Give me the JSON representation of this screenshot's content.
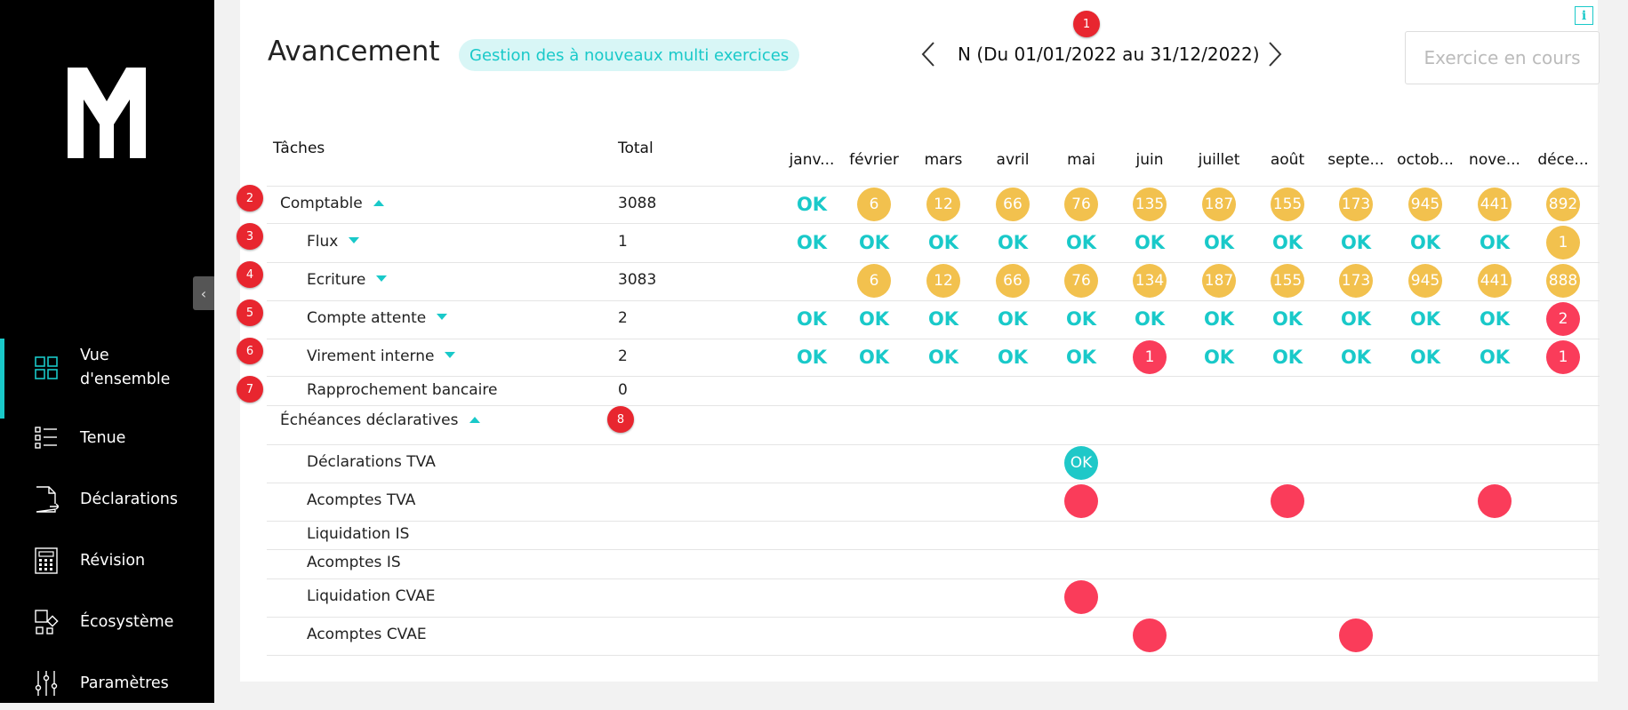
{
  "sidebar": {
    "items": [
      {
        "label": "Vue d'ensemble",
        "icon": "grid-icon",
        "active": true
      },
      {
        "label": "Tenue",
        "icon": "list-icon"
      },
      {
        "label": "Déclarations",
        "icon": "document-icon"
      },
      {
        "label": "Révision",
        "icon": "calculator-icon"
      },
      {
        "label": "Écosystème",
        "icon": "ecosystem-icon"
      },
      {
        "label": "Paramètres",
        "icon": "sliders-icon"
      }
    ]
  },
  "header": {
    "title": "Avancement",
    "tag": "Gestion des à nouveaux multi exercices",
    "period": "N (Du 01/01/2022 au 31/12/2022)",
    "exercise_button": "Exercice en cours",
    "info_icon": "i"
  },
  "markers": [
    "1",
    "2",
    "3",
    "4",
    "5",
    "6",
    "7",
    "8"
  ],
  "table": {
    "col_tasks": "Tâches",
    "col_total": "Total",
    "months": [
      "janv...",
      "février",
      "mars",
      "avril",
      "mai",
      "juin",
      "juillet",
      "août",
      "septe...",
      "octob...",
      "nove...",
      "déce..."
    ],
    "rows": [
      {
        "label": "Comptable",
        "caret": "up",
        "total": "3088",
        "cells": [
          "OK",
          "6",
          "12",
          "66",
          "76",
          "135",
          "187",
          "155",
          "173",
          "945",
          "441",
          "892"
        ],
        "kinds": [
          "ok",
          "warn",
          "warn",
          "warn",
          "warn",
          "warn",
          "warn",
          "warn",
          "warn",
          "warn",
          "warn",
          "warn"
        ]
      },
      {
        "label": "Flux",
        "caret": "down",
        "total": "1",
        "cells": [
          "OK",
          "OK",
          "OK",
          "OK",
          "OK",
          "OK",
          "OK",
          "OK",
          "OK",
          "OK",
          "OK",
          "1"
        ],
        "kinds": [
          "ok",
          "ok",
          "ok",
          "ok",
          "ok",
          "ok",
          "ok",
          "ok",
          "ok",
          "ok",
          "ok",
          "warn"
        ]
      },
      {
        "label": "Ecriture",
        "caret": "down",
        "total": "3083",
        "cells": [
          "",
          "6",
          "12",
          "66",
          "76",
          "134",
          "187",
          "155",
          "173",
          "945",
          "441",
          "888"
        ],
        "kinds": [
          "",
          "warn",
          "warn",
          "warn",
          "warn",
          "warn",
          "warn",
          "warn",
          "warn",
          "warn",
          "warn",
          "warn"
        ]
      },
      {
        "label": "Compte attente",
        "caret": "down",
        "total": "2",
        "cells": [
          "OK",
          "OK",
          "OK",
          "OK",
          "OK",
          "OK",
          "OK",
          "OK",
          "OK",
          "OK",
          "OK",
          "2"
        ],
        "kinds": [
          "ok",
          "ok",
          "ok",
          "ok",
          "ok",
          "ok",
          "ok",
          "ok",
          "ok",
          "ok",
          "ok",
          "error"
        ]
      },
      {
        "label": "Virement interne",
        "caret": "down",
        "total": "2",
        "cells": [
          "OK",
          "OK",
          "OK",
          "OK",
          "OK",
          "1",
          "OK",
          "OK",
          "OK",
          "OK",
          "OK",
          "1"
        ],
        "kinds": [
          "ok",
          "ok",
          "ok",
          "ok",
          "ok",
          "error",
          "ok",
          "ok",
          "ok",
          "ok",
          "ok",
          "error"
        ]
      },
      {
        "label": "Rapprochement bancaire",
        "caret": "",
        "total": "0",
        "cells": [
          "",
          "",
          "",
          "",
          "",
          "",
          "",
          "",
          "",
          "",
          "",
          ""
        ],
        "kinds": [
          "",
          "",
          "",
          "",
          "",
          "",
          "",
          "",
          "",
          "",
          "",
          ""
        ]
      },
      {
        "label": "Échéances déclaratives",
        "caret": "up",
        "total": "",
        "cells": [
          "",
          "",
          "",
          "",
          "",
          "",
          "",
          "",
          "",
          "",
          "",
          ""
        ],
        "kinds": [
          "",
          "",
          "",
          "",
          "",
          "",
          "",
          "",
          "",
          "",
          "",
          ""
        ]
      },
      {
        "label": "Déclarations TVA",
        "caret": "",
        "total": "",
        "cells": [
          "",
          "",
          "",
          "",
          "OK",
          "",
          "",
          "",
          "",
          "",
          "",
          ""
        ],
        "kinds": [
          "",
          "",
          "",
          "",
          "done",
          "",
          "",
          "",
          "",
          "",
          "",
          ""
        ]
      },
      {
        "label": "Acomptes TVA",
        "caret": "",
        "total": "",
        "cells": [
          "",
          "",
          "",
          "",
          "",
          "",
          "",
          "",
          "",
          "",
          "",
          ""
        ],
        "kinds": [
          "",
          "",
          "",
          "",
          "error",
          "",
          "",
          "error",
          "",
          "",
          "error",
          ""
        ]
      },
      {
        "label": "Liquidation IS",
        "caret": "",
        "total": "",
        "cells": [
          "",
          "",
          "",
          "",
          "",
          "",
          "",
          "",
          "",
          "",
          "",
          ""
        ],
        "kinds": [
          "",
          "",
          "",
          "",
          "",
          "",
          "",
          "",
          "",
          "",
          "",
          ""
        ]
      },
      {
        "label": "Acomptes IS",
        "caret": "",
        "total": "",
        "cells": [
          "",
          "",
          "",
          "",
          "",
          "",
          "",
          "",
          "",
          "",
          "",
          ""
        ],
        "kinds": [
          "",
          "",
          "",
          "",
          "",
          "",
          "",
          "",
          "",
          "",
          "",
          ""
        ]
      },
      {
        "label": "Liquidation CVAE",
        "caret": "",
        "total": "",
        "cells": [
          "",
          "",
          "",
          "",
          "",
          "",
          "",
          "",
          "",
          "",
          "",
          ""
        ],
        "kinds": [
          "",
          "",
          "",
          "",
          "error",
          "",
          "",
          "",
          "",
          "",
          "",
          ""
        ]
      },
      {
        "label": "Acomptes CVAE",
        "caret": "",
        "total": "",
        "cells": [
          "",
          "",
          "",
          "",
          "",
          "",
          "",
          "",
          "",
          "",
          "",
          ""
        ],
        "kinds": [
          "",
          "",
          "",
          "",
          "",
          "error",
          "",
          "",
          "error",
          "",
          "",
          ""
        ]
      }
    ]
  }
}
